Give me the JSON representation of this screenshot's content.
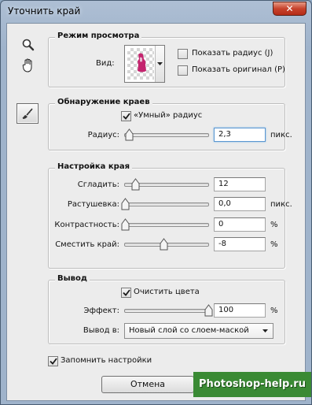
{
  "window": {
    "title": "Уточнить край",
    "close_glyph": "✕"
  },
  "tools": [
    {
      "icon": "zoom-icon"
    },
    {
      "icon": "hand-icon"
    },
    {
      "icon": "refine-radius-brush-icon",
      "selected": true
    }
  ],
  "view_mode": {
    "title": "Режим просмотра",
    "view_label": "Вид:",
    "show_radius": {
      "label": "Показать радиус (J)",
      "checked": false
    },
    "show_original": {
      "label": "Показать оригинал (P)",
      "checked": false
    }
  },
  "edge_detection": {
    "title": "Обнаружение краев",
    "smart_radius": {
      "label": "«Умный» радиус",
      "checked": true
    },
    "radius": {
      "label": "Радиус:",
      "value": "2,3",
      "unit": "пикс.",
      "slider_fraction": 0.05
    }
  },
  "adjust_edge": {
    "title": "Настройка края",
    "smooth": {
      "label": "Сгладить:",
      "value": "12",
      "unit": "",
      "slider_fraction": 0.12
    },
    "feather": {
      "label": "Растушевка:",
      "value": "0,0",
      "unit": "пикс.",
      "slider_fraction": 0.0
    },
    "contrast": {
      "label": "Контрастность:",
      "value": "0",
      "unit": "%",
      "slider_fraction": 0.0
    },
    "shift_edge": {
      "label": "Сместить край:",
      "value": "-8",
      "unit": "%",
      "slider_fraction": 0.46
    }
  },
  "output": {
    "title": "Вывод",
    "decontaminate": {
      "label": "Очистить цвета",
      "checked": true
    },
    "amount": {
      "label": "Эффект:",
      "value": "100",
      "unit": "%",
      "slider_fraction": 1.0
    },
    "output_to": {
      "label": "Вывод в:",
      "selected": "Новый слой со слоем-маской"
    }
  },
  "remember": {
    "label": "Запомнить настройки",
    "checked": true
  },
  "buttons": {
    "cancel": "Отмена"
  },
  "watermark": "Photoshop-help.ru",
  "colors": {
    "accent_focus": "#5b97d1",
    "watermark_bg": "#3a8a34",
    "close_red": "#c7422c"
  }
}
